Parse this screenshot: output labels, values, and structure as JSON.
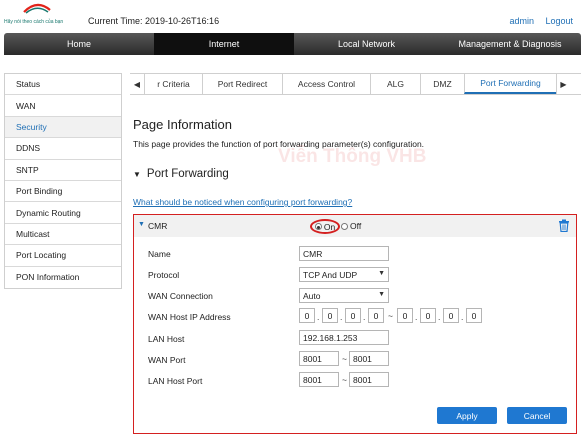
{
  "header": {
    "brand_tagline": "Hãy nói theo cách của bạn",
    "current_time": "Current Time: 2019-10-26T16:16",
    "user": "admin",
    "logout": "Logout"
  },
  "main_nav": [
    "Home",
    "Internet",
    "Local Network",
    "Management & Diagnosis"
  ],
  "main_nav_active": "Internet",
  "sidebar": [
    "Status",
    "WAN",
    "Security",
    "DDNS",
    "SNTP",
    "Port Binding",
    "Dynamic Routing",
    "Multicast",
    "Port Locating",
    "PON Information"
  ],
  "sidebar_active": "Security",
  "tabs": {
    "left_arrow": "◀",
    "right_arrow": "▶",
    "items": [
      "r Criteria",
      "Port Redirect",
      "Access Control",
      "ALG",
      "DMZ",
      "Port Forwarding"
    ],
    "active": "Port Forwarding"
  },
  "page": {
    "title": "Page Information",
    "description": "This page provides the function of port forwarding parameter(s) configuration.",
    "watermark": "Viễn Thông VHB",
    "section_title": "Port Forwarding",
    "section_toggle": "▼",
    "help_link": "What should be noticed when configuring port forwarding?"
  },
  "rule": {
    "toggle": "▼",
    "name": "CMR",
    "on_label": "On",
    "off_label": "Off",
    "enabled": "On",
    "labels": {
      "name": "Name",
      "protocol": "Protocol",
      "wan_connection": "WAN Connection",
      "wan_host_ip": "WAN Host IP Address",
      "lan_host": "LAN Host",
      "wan_port": "WAN Port",
      "lan_host_port": "LAN Host Port"
    },
    "values": {
      "name": "CMR",
      "protocol": "TCP And UDP",
      "wan_connection": "Auto",
      "wan_ip_start": [
        "0",
        "0",
        "0",
        "0"
      ],
      "wan_ip_end": [
        "0",
        "0",
        "0",
        "0"
      ],
      "lan_host": "192.168.1.253",
      "wan_port_start": "8001",
      "wan_port_end": "8001",
      "lan_port_start": "8001",
      "lan_port_end": "8001"
    },
    "dot": ".",
    "tilde": "~",
    "caret": "▼"
  },
  "buttons": {
    "apply": "Apply",
    "cancel": "Cancel"
  },
  "colors": {
    "accent": "#1f78d1",
    "link": "#1f6fb5",
    "highlight": "#d42020",
    "nav_bg": "#2a2a2a",
    "brand_red": "#e2231a",
    "brand_teal": "#19786e"
  },
  "icons": {
    "logo": "viettel-logo",
    "delete": "trash-icon"
  }
}
